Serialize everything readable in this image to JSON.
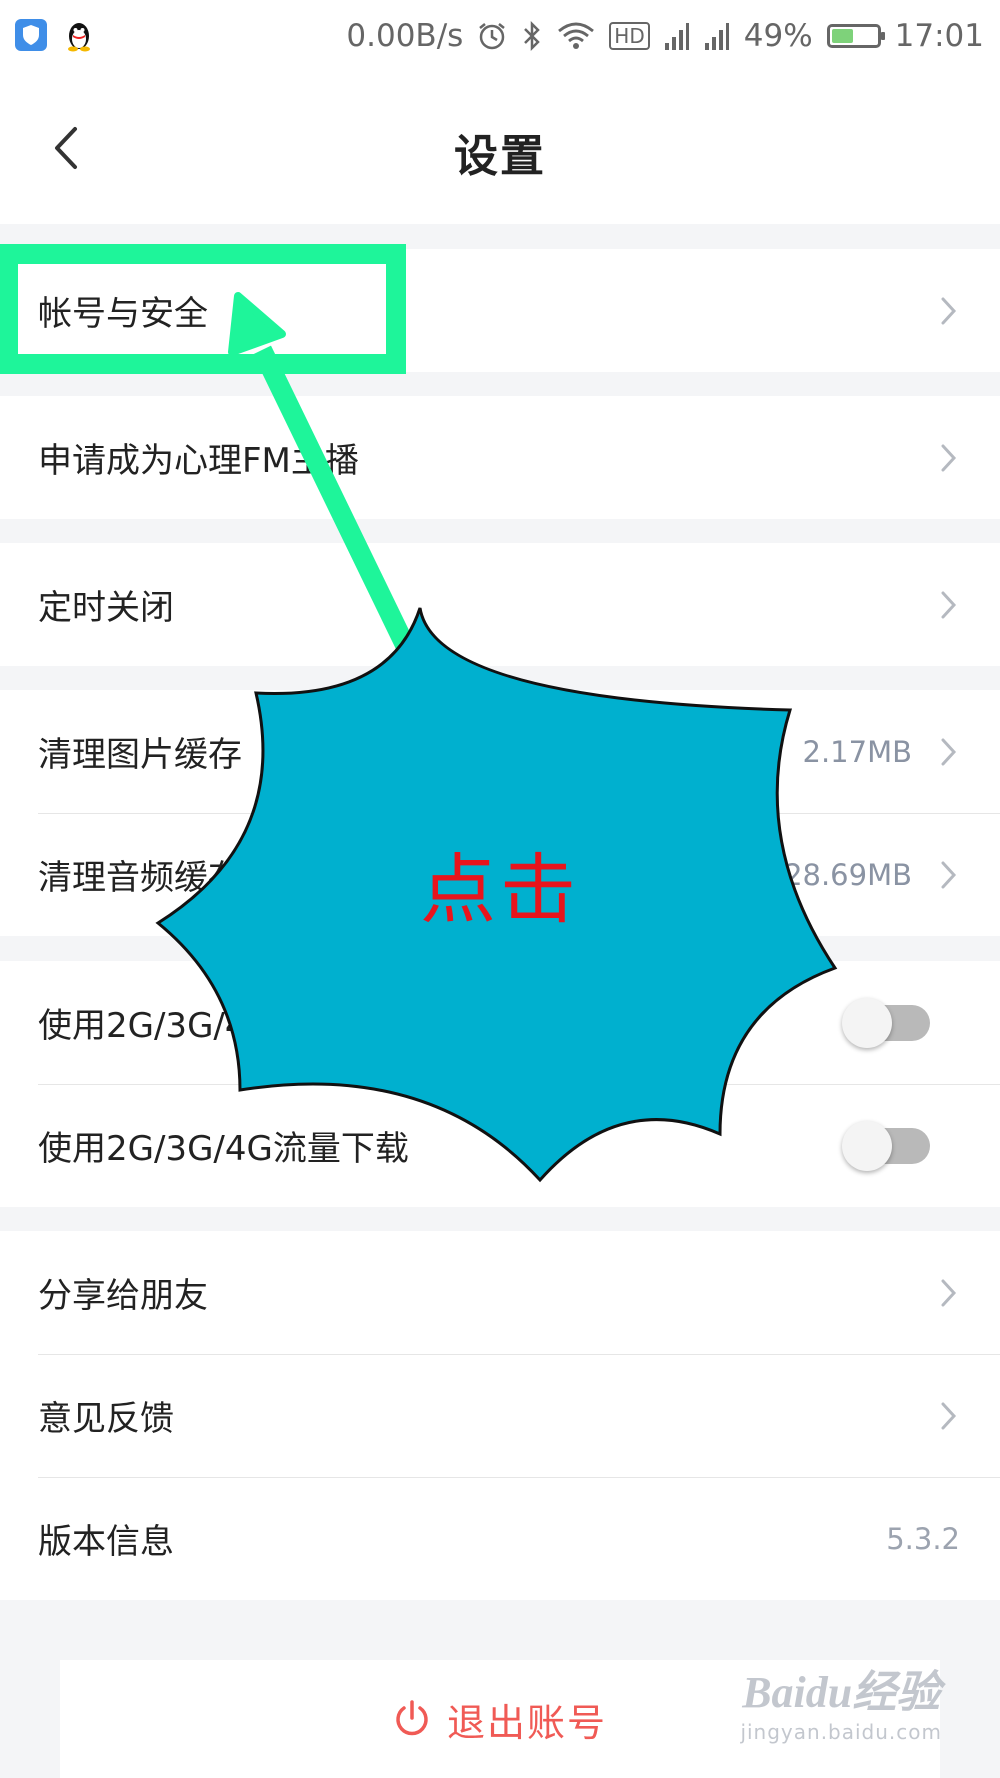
{
  "status_bar": {
    "net_speed": "0.00B/s",
    "hd_badge": "HD",
    "battery_percent": "49%",
    "battery_level": 0.49,
    "time": "17:01",
    "icons": [
      "shield-icon",
      "qq-penguin-icon",
      "alarm-icon",
      "bluetooth-icon",
      "wifi-icon",
      "signal-icon",
      "battery-icon"
    ]
  },
  "nav": {
    "title": "设置",
    "back_icon": "chevron-left-icon"
  },
  "groups": {
    "account": {
      "label": "帐号与安全"
    },
    "apply": {
      "label": "申请成为心理FM主播"
    },
    "timer": {
      "label": "定时关闭"
    },
    "cache": {
      "image_label": "清理图片缓存",
      "image_value": "2.17MB",
      "audio_label": "清理音频缓存",
      "audio_value": "28.69MB"
    },
    "network": {
      "play_label": "使用2G/3G/4G流量播放",
      "play_on": false,
      "download_label": "使用2G/3G/4G流量下载",
      "download_on": false
    },
    "misc": {
      "share_label": "分享给朋友",
      "feedback_label": "意见反馈",
      "version_label": "版本信息",
      "version_value": "5.3.2"
    }
  },
  "logout": {
    "label": "退出账号",
    "icon": "power-icon"
  },
  "annotation": {
    "callout_text": "点击",
    "highlight_color": "#1ef59a",
    "burst_color": "#00b0cf",
    "text_color": "#e8141c"
  },
  "watermark": {
    "main": "Baidu经验",
    "sub": "jingyan.baidu.com"
  }
}
